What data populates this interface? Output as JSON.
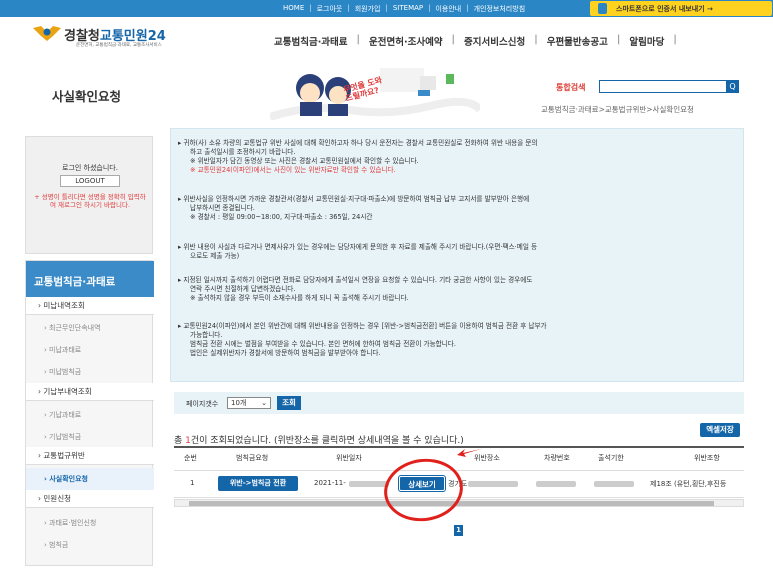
{
  "topbar": {
    "links": [
      "HOME",
      "로그아웃",
      "회원가입",
      "SITEMAP",
      "이용안내",
      "개인정보처리방침"
    ],
    "app_button": "스마트폰으로 인증서 내보내기 →"
  },
  "logo": {
    "title_prefix": "경찰청",
    "title_suffix": "교통민원24",
    "subtitle": "운전면허, 교통범칙금·과태료, 교통조사서비스"
  },
  "nav": {
    "items": [
      "교통범칙금·과태료",
      "운전면허·조사예약",
      "증지서비스신청",
      "우편물반송공고",
      "알림마당"
    ]
  },
  "banner": {
    "page_title": "사실확인요청",
    "search_label": "통합검색",
    "search_button": "Q",
    "breadcrumb": "교통범칙금·과태료>교통법규위반>사실확인요청",
    "mascot_text": "무엇을 도와드릴까요?"
  },
  "login": {
    "status": "로그인 하셨습니다.",
    "logout_label": "LOGOUT",
    "note": "+ 성명이 틀리다면 성명을 정확히 입력하여 재로그인 하시기 바랍니다."
  },
  "sidebar": {
    "heading": "교통범칙금·과태료",
    "items": [
      {
        "label": "미납내역조회",
        "type": "main"
      },
      {
        "label": "최근무인단속내역",
        "type": "sub"
      },
      {
        "label": "미납과태료",
        "type": "sub"
      },
      {
        "label": "미납범칙금",
        "type": "sub"
      },
      {
        "label": "기납부내역조회",
        "type": "main"
      },
      {
        "label": "기납과태료",
        "type": "sub"
      },
      {
        "label": "기납범칙금",
        "type": "sub"
      },
      {
        "label": "교통법규위반",
        "type": "main"
      },
      {
        "label": "사실확인요청",
        "type": "sub-active"
      },
      {
        "label": "민원신청",
        "type": "main"
      },
      {
        "label": "과태료·범인신청",
        "type": "sub"
      },
      {
        "label": "범칙금",
        "type": "sub"
      }
    ]
  },
  "info": {
    "p1a": "▸ 귀하(사) 소유 차량의 교통법규 위반 사실에 대해 확인하고자 하나 당시 운전자는 경찰서 교통민원실로 전화하여 위반 내용을 문의",
    "p1b": "하고 출석일시를 조정하시기 바랍니다.",
    "p1c": "※ 위반일자가 담긴 동영상 또는 사진은 경찰서 교통민원실에서 확인할 수 있습니다.",
    "p1d": "※ 교통민원24(이파인)에서는 사진이 있는 위반자료만 확인할 수 있습니다.",
    "p2a": "▸ 위반사실을 인정하시면 가까운 경찰관서(경찰서 교통민원실·지구대·파출소)에 방문하여 범칙금 납부 고지서를 발부받아 은행에",
    "p2b": "납부하시면 종결됩니다.",
    "p2c": "※ 경찰서 : 평일 09:00~18:00, 지구대·파출소 : 365일, 24시간",
    "p3a": "▸ 위반 내용이 사실과 다르거나 면제사유가 있는 경우에는 담당자에게 문의한 후 자료를 제출해 주시기 바랍니다.(우편·팩스·메일 등",
    "p3b": "으로도 제출 가능)",
    "p4a": "▸ 지정된 일시까지 출석하기 어렵다면 전화로 담당자에게 출석일시 연장을 요청할 수 있습니다. 기타 궁금한 사항이 있는 경우에도",
    "p4b": "연락 주시면 친절하게 답변하겠습니다.",
    "p4c": "※ 출석하지 않을 경우 부득이 소재수사를 하게 되니 꼭 출석해 주시기 바랍니다.",
    "p5a": "▸ 교통민원24(이파인)에서 본인 위반건에 대해 위반내용을 인정하는 경우 [위반->범칙금전환] 버튼을 이용하여 범칙금 전환 후 납부가",
    "p5b": "가능합니다.",
    "p5c": "범칙금 전환 시에는 벌점을 부여받을 수 있습니다. 본인 면허에 한하여 범칙금 전환이 가능합니다.",
    "p5d": "법인은 실제위반자가 경찰서에 방문하여 범칙금을 발부받아야 합니다."
  },
  "pager": {
    "label": "페이지갯수",
    "selected": "10개",
    "button": "조회"
  },
  "results": {
    "prefix": "총 ",
    "count": "1",
    "suffix": "건이 조회되었습니다. (위반장소를 클릭하면 상세내역을 볼 수 있습니다.)",
    "excel_button": "엑셀저장",
    "columns": [
      "순번",
      "범칙금요청",
      "위반일자",
      "위반장소",
      "차량번호",
      "출석기한",
      "위반조항"
    ],
    "row": {
      "index": "1",
      "convert_button": "위반->범칙금 전환",
      "date": "2021-11-",
      "detail_button": "상세보기",
      "place_prefix": "경기도",
      "law": "제18조 (유턴,횡단,후진등"
    },
    "page_number": "1"
  }
}
